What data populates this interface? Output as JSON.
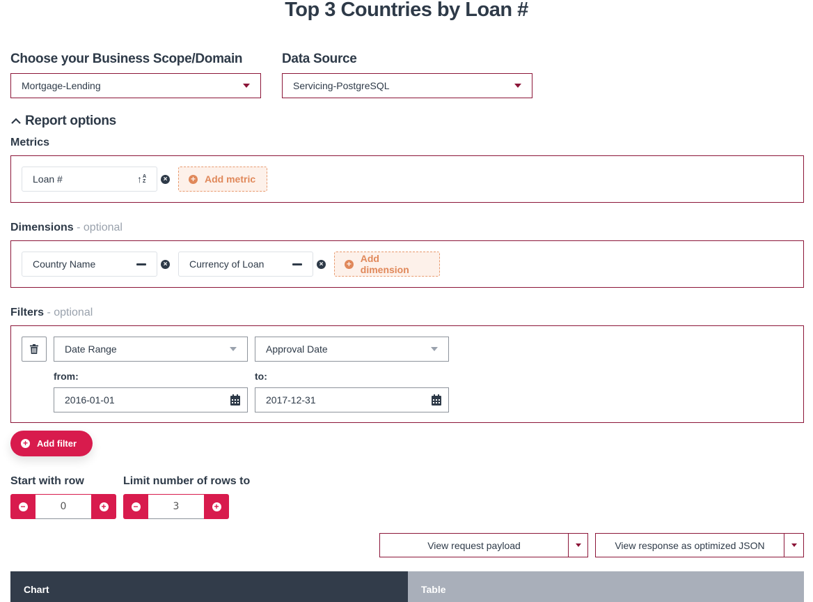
{
  "page": {
    "title": "Top 3 Countries by Loan #"
  },
  "scope": {
    "label": "Choose your Business Scope/Domain",
    "selected": "Mortgage-Lending"
  },
  "datasource": {
    "label": "Data Source",
    "selected": "Servicing-PostgreSQL"
  },
  "report_options": {
    "toggle_label": "Report options",
    "expanded": true,
    "metrics": {
      "label": "Metrics",
      "items": [
        {
          "name": "Loan #",
          "sort_icon": "sort-alpha-icon"
        }
      ],
      "add_label": "Add metric"
    },
    "dimensions": {
      "label": "Dimensions",
      "optional": " - optional",
      "items": [
        {
          "name": "Country Name"
        },
        {
          "name": "Currency of Loan"
        }
      ],
      "add_label": "Add dimension"
    },
    "filters": {
      "label": "Filters",
      "optional": " - optional",
      "items": [
        {
          "type": "Date Range",
          "field": "Approval Date",
          "from_label": "from:",
          "from_value": "2016-01-01",
          "to_label": "to:",
          "to_value": "2017-12-31"
        }
      ],
      "add_label": "Add filter"
    },
    "start_row": {
      "label": "Start with row",
      "value": "0"
    },
    "limit_rows": {
      "label": "Limit number of rows to",
      "value": "3"
    }
  },
  "actions": {
    "view_request": "View request payload",
    "view_response": "View response as optimized JSON"
  },
  "tabs": [
    {
      "label": "Chart",
      "active": true
    },
    {
      "label": "Table",
      "active": false
    }
  ],
  "colors": {
    "accent": "#8b1538",
    "primary_button": "#d81b4d",
    "dark": "#2e3a48",
    "add_dashed": "#e0885a",
    "tab_active": "#323c4a",
    "tab_inactive": "#a9afba"
  }
}
